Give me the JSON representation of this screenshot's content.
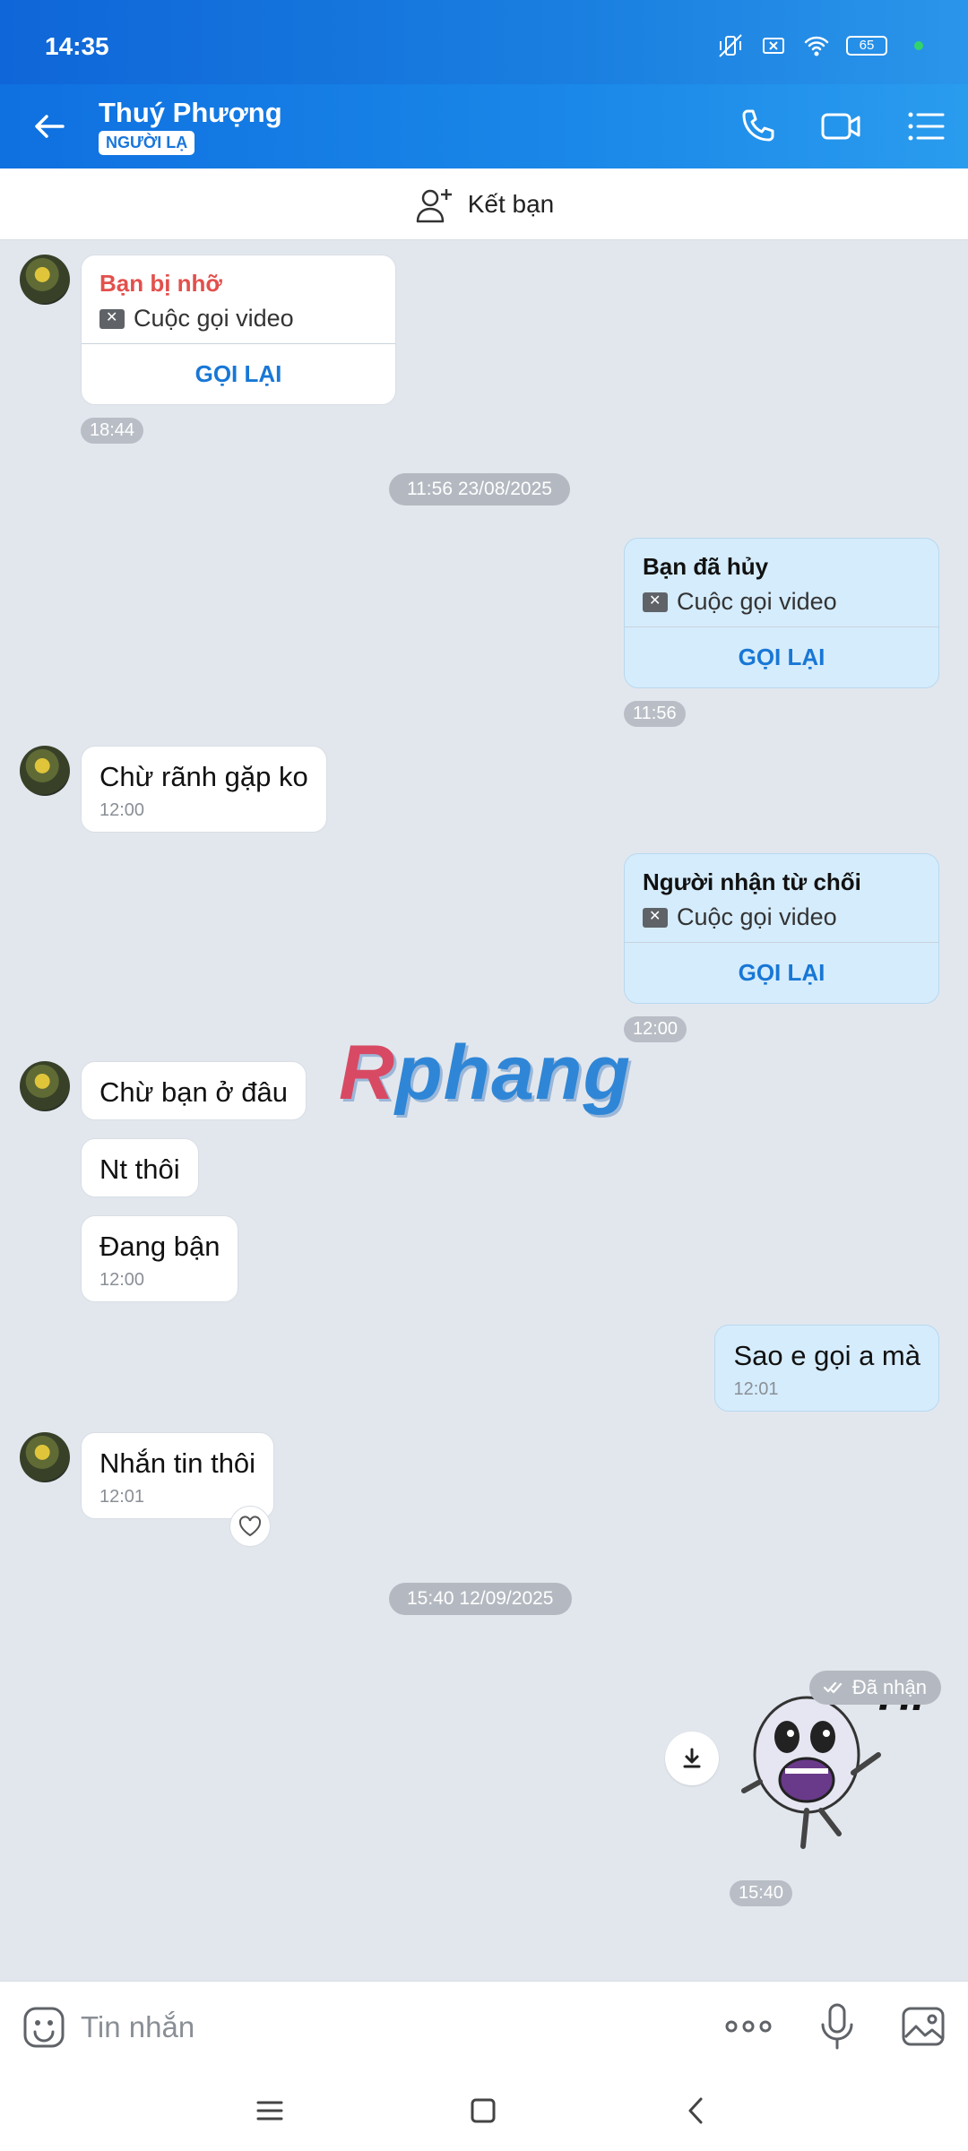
{
  "status_bar": {
    "time": "14:35",
    "battery": "65"
  },
  "header": {
    "name": "Thuý Phượng",
    "badge": "NGƯỜI LẠ"
  },
  "add_friend": {
    "label": "Kết bạn"
  },
  "messages": {
    "missed_call": {
      "title": "Bạn bị nhỡ",
      "type": "Cuộc gọi video",
      "action": "GỌI LẠI",
      "time": "18:44"
    },
    "date1": "11:56 23/08/2025",
    "cancelled_call": {
      "title": "Bạn đã hủy",
      "type": "Cuộc gọi video",
      "action": "GỌI LẠI",
      "time": "11:56"
    },
    "m1": {
      "text": "Chừ rãnh gặp ko",
      "time": "12:00"
    },
    "rejected_call": {
      "title": "Người nhận từ chối",
      "type": "Cuộc gọi video",
      "action": "GỌI LẠI",
      "time": "12:00"
    },
    "m2": {
      "text": "Chừ bạn ở đâu"
    },
    "m3": {
      "text": "Nt thôi"
    },
    "m4": {
      "text": "Đang bận",
      "time": "12:00"
    },
    "m5": {
      "text": "Sao e gọi a mà",
      "time": "12:01"
    },
    "m6": {
      "text": "Nhắn tin thôi",
      "time": "12:01"
    },
    "date2": "15:40 12/09/2025",
    "sticker_time": "15:40",
    "sticker_text": "Hi",
    "delivery_status": "Đã nhận"
  },
  "watermark": {
    "part1": "R",
    "part2": "phang"
  },
  "input": {
    "placeholder": "Tin nhắn"
  },
  "colors": {
    "accent": "#1876dc",
    "missed": "#e2504c",
    "outgoing_bubble": "#d5ecfc"
  }
}
